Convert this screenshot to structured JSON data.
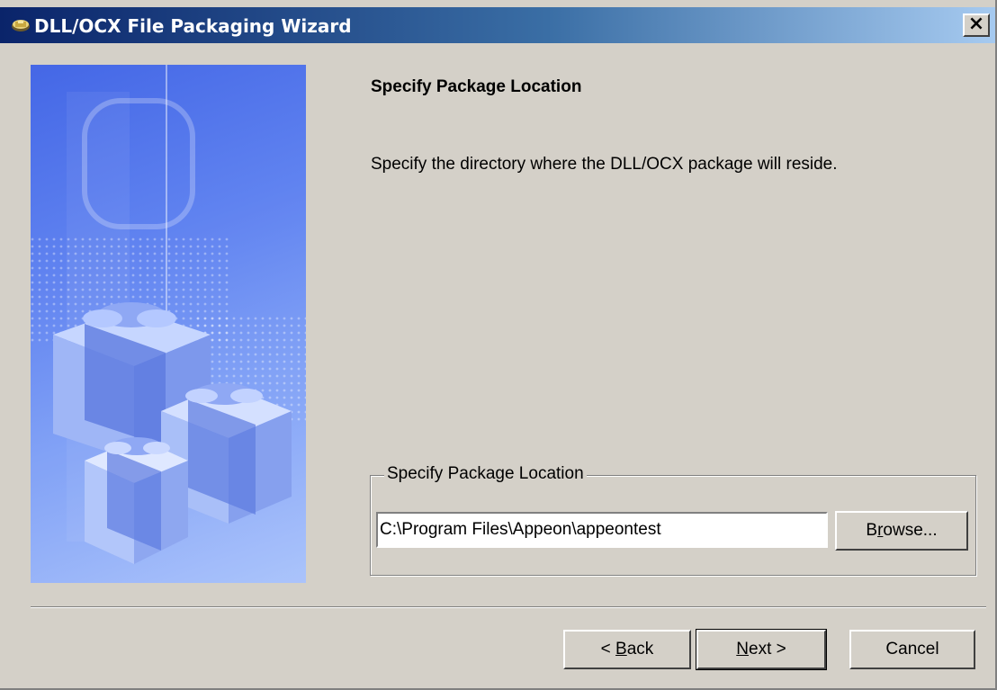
{
  "window": {
    "title": "DLL/OCX File Packaging Wizard",
    "close_label": "×"
  },
  "page": {
    "heading": "Specify Package Location",
    "description": "Specify the directory where the DLL/OCX package will reside."
  },
  "location_group": {
    "label": "Specify Package Location",
    "path_value": "C:\\Program Files\\Appeon\\appeontest",
    "browse_pre": "B",
    "browse_accel": "r",
    "browse_post": "owse..."
  },
  "footer": {
    "back_pre": "< ",
    "back_accel": "B",
    "back_post": "ack",
    "next_accel": "N",
    "next_post": "ext >",
    "cancel_label": "Cancel"
  },
  "colors": {
    "dialog_bg": "#d4d0c8",
    "titlebar_start": "#0a246a",
    "titlebar_end": "#a6caf0",
    "panel_blue": "#5b7ff0"
  },
  "icons": {
    "app_icon": "package-icon",
    "side_image": "gift-boxes-illustration"
  }
}
